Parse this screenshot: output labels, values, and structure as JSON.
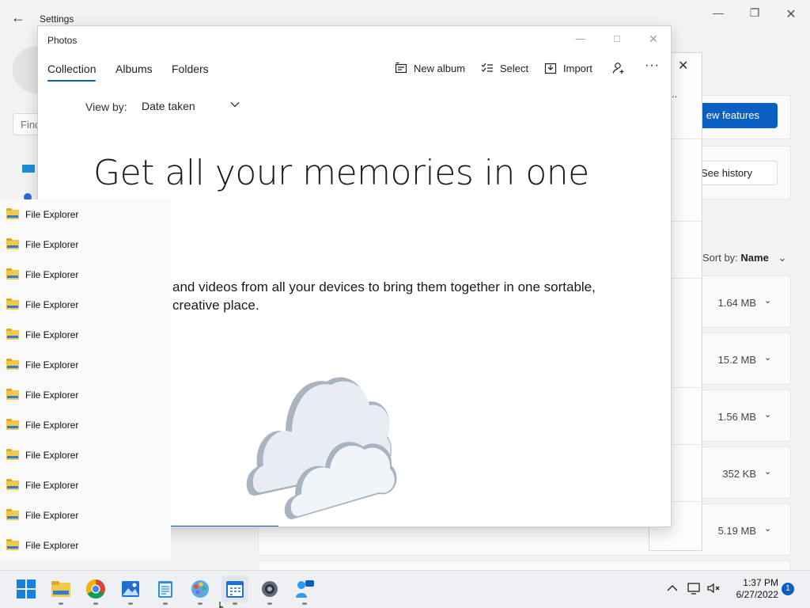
{
  "settings": {
    "title": "Settings",
    "find_placeholder": "Find",
    "new_features_button": "ew features",
    "see_history_button": "See history",
    "sort_label": "Sort by:",
    "sort_value": "Name",
    "rows": [
      {
        "size": "1.64 MB"
      },
      {
        "size": "15.2 MB"
      },
      {
        "size": "1.56 MB"
      },
      {
        "size": "352 KB"
      },
      {
        "size": "5.19 MB"
      }
    ]
  },
  "photos": {
    "title": "Photos",
    "tabs": [
      {
        "label": "Collection"
      },
      {
        "label": "Albums"
      },
      {
        "label": "Folders"
      }
    ],
    "toolbar": {
      "new_album": "New album",
      "select": "Select",
      "import": "Import",
      "more": "···"
    },
    "view_by_label": "View by:",
    "view_by_value": "Date taken",
    "hero_title": "Get all your memories in one",
    "description": "and videos from all your devices to bring them together in one sortable, creative place."
  },
  "jumplist": {
    "items": [
      {
        "label": "File Explorer"
      },
      {
        "label": "File Explorer"
      },
      {
        "label": "File Explorer"
      },
      {
        "label": "File Explorer"
      },
      {
        "label": "File Explorer"
      },
      {
        "label": "File Explorer"
      },
      {
        "label": "File Explorer"
      },
      {
        "label": "File Explorer"
      },
      {
        "label": "File Explorer"
      },
      {
        "label": "File Explorer"
      },
      {
        "label": "File Explorer"
      },
      {
        "label": "File Explorer"
      }
    ]
  },
  "taskbar": {
    "time": "1:37 PM",
    "date": "6/27/2022",
    "notification_count": "1",
    "apps": [
      {
        "icon": "start-icon"
      },
      {
        "icon": "file-explorer-icon"
      },
      {
        "icon": "chrome-icon"
      },
      {
        "icon": "photos-icon"
      },
      {
        "icon": "notepad-icon"
      },
      {
        "icon": "paint-icon"
      },
      {
        "icon": "calendar-icon"
      },
      {
        "icon": "settings-gear-icon"
      },
      {
        "icon": "feedback-icon"
      }
    ]
  },
  "colors": {
    "accent": "#0a5fc2",
    "folder": "#f3c64c"
  }
}
